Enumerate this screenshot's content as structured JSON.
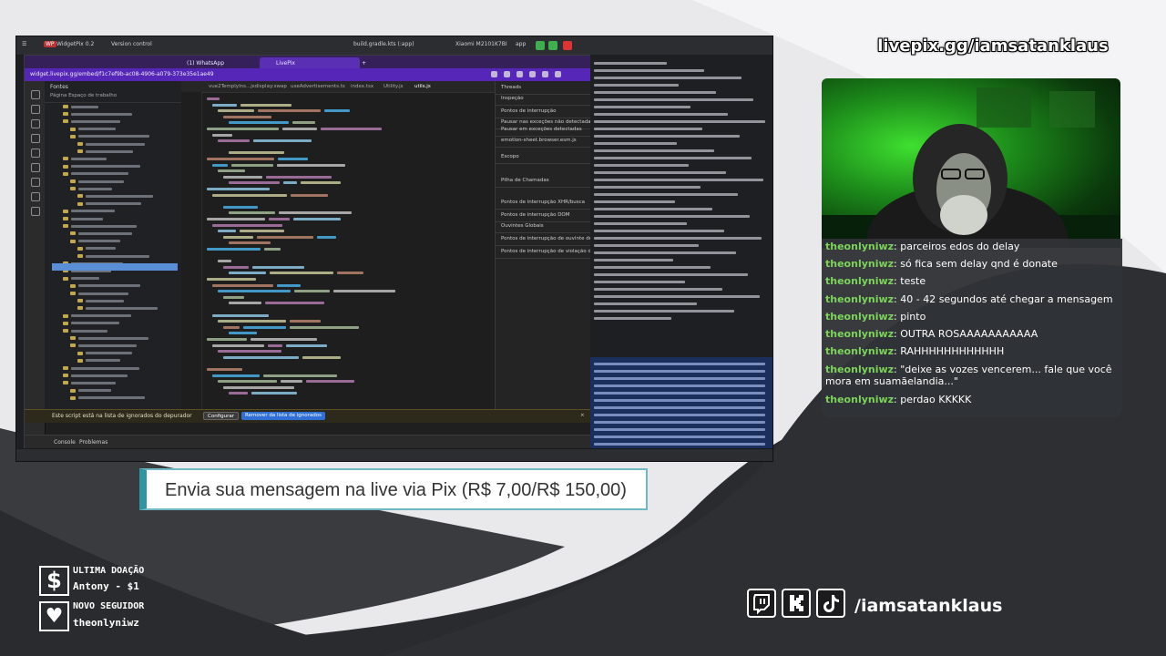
{
  "overlay": {
    "handle_top": "livepix.gg/iamsatanklaus",
    "pix_banner": "Envia sua mensagem na live via Pix (R$ 7,00/R$ 150,00)",
    "last_donation_label": "ULTIMA DOAÇÃO",
    "last_donation_value": "Antony - $1",
    "new_follower_label": "NOVO SEGUIDOR",
    "new_follower_value": "theonlyniwz",
    "social_handle": "/iamsatanklaus",
    "icons": [
      "dollar-icon",
      "heart-icon",
      "twitch-icon",
      "kick-icon",
      "tiktok-icon"
    ]
  },
  "chat": {
    "messages": [
      {
        "user": "theonlyniwz",
        "text": "parceiros edos do delay"
      },
      {
        "user": "theonlyniwz",
        "text": "só fica sem delay qnd é donate"
      },
      {
        "user": "theonlyniwz",
        "text": "teste"
      },
      {
        "user": "theonlyniwz",
        "text": "40 - 42 segundos até chegar a mensagem"
      },
      {
        "user": "theonlyniwz",
        "text": "pinto"
      },
      {
        "user": "theonlyniwz",
        "text": "OUTRA ROSAAAAAAAAAAA"
      },
      {
        "user": "theonlyniwz",
        "text": "RAHHHHHHHHHHHH"
      },
      {
        "user": "theonlyniwz",
        "text": "\"deixe as vozes vencerem... fale que você mora em suamãelandia...\""
      },
      {
        "user": "theonlyniwz",
        "text": "perdao KKKKK"
      }
    ]
  },
  "screen": {
    "ide": {
      "project": "WidgetPix 0.2",
      "vcs": "Version control",
      "build": "build.gradle.kts (:app)",
      "device": "Xiaomi M2101K7BI",
      "module": "app"
    },
    "browser": {
      "tabs": [
        "(1) WhatsApp",
        "LivePix"
      ],
      "url": "widget.livepix.gg/embed/f1c7ef9b-ac08-4906-a079-373e35e1ae49"
    },
    "devtools": {
      "sources_title": "Fontes",
      "nav_tabs": "Página    Espaço de trabalho",
      "file_tabs": [
        "vue2TemplyIns...jsdisplay:swap",
        "useAdvertisements.ts",
        "index.tsx",
        "Utility.js",
        "utils.js"
      ],
      "debugger_rows": [
        "Threads",
        "Inspeção",
        "Pontos de interrupção",
        "Pausar nas exceções não detectadas",
        "Pausar em exceções detectadas",
        "emotion-sheet.browser.esm.js",
        "Escopo",
        "Pilha de Chamadas",
        "Pontos de interrupção XHR/busca",
        "Pontos de interrupção DOM",
        "Ouvintes Globais",
        "Pontos de interrupção de ouvinte de",
        "Pontos de interrupção de violação do"
      ],
      "info_msg": "Este script está na lista de ignorados do depurador",
      "info_configure": "Configurar",
      "info_remove": "Remover da lista de ignorados",
      "console_tabs": [
        "Console",
        "Problemas"
      ]
    }
  }
}
